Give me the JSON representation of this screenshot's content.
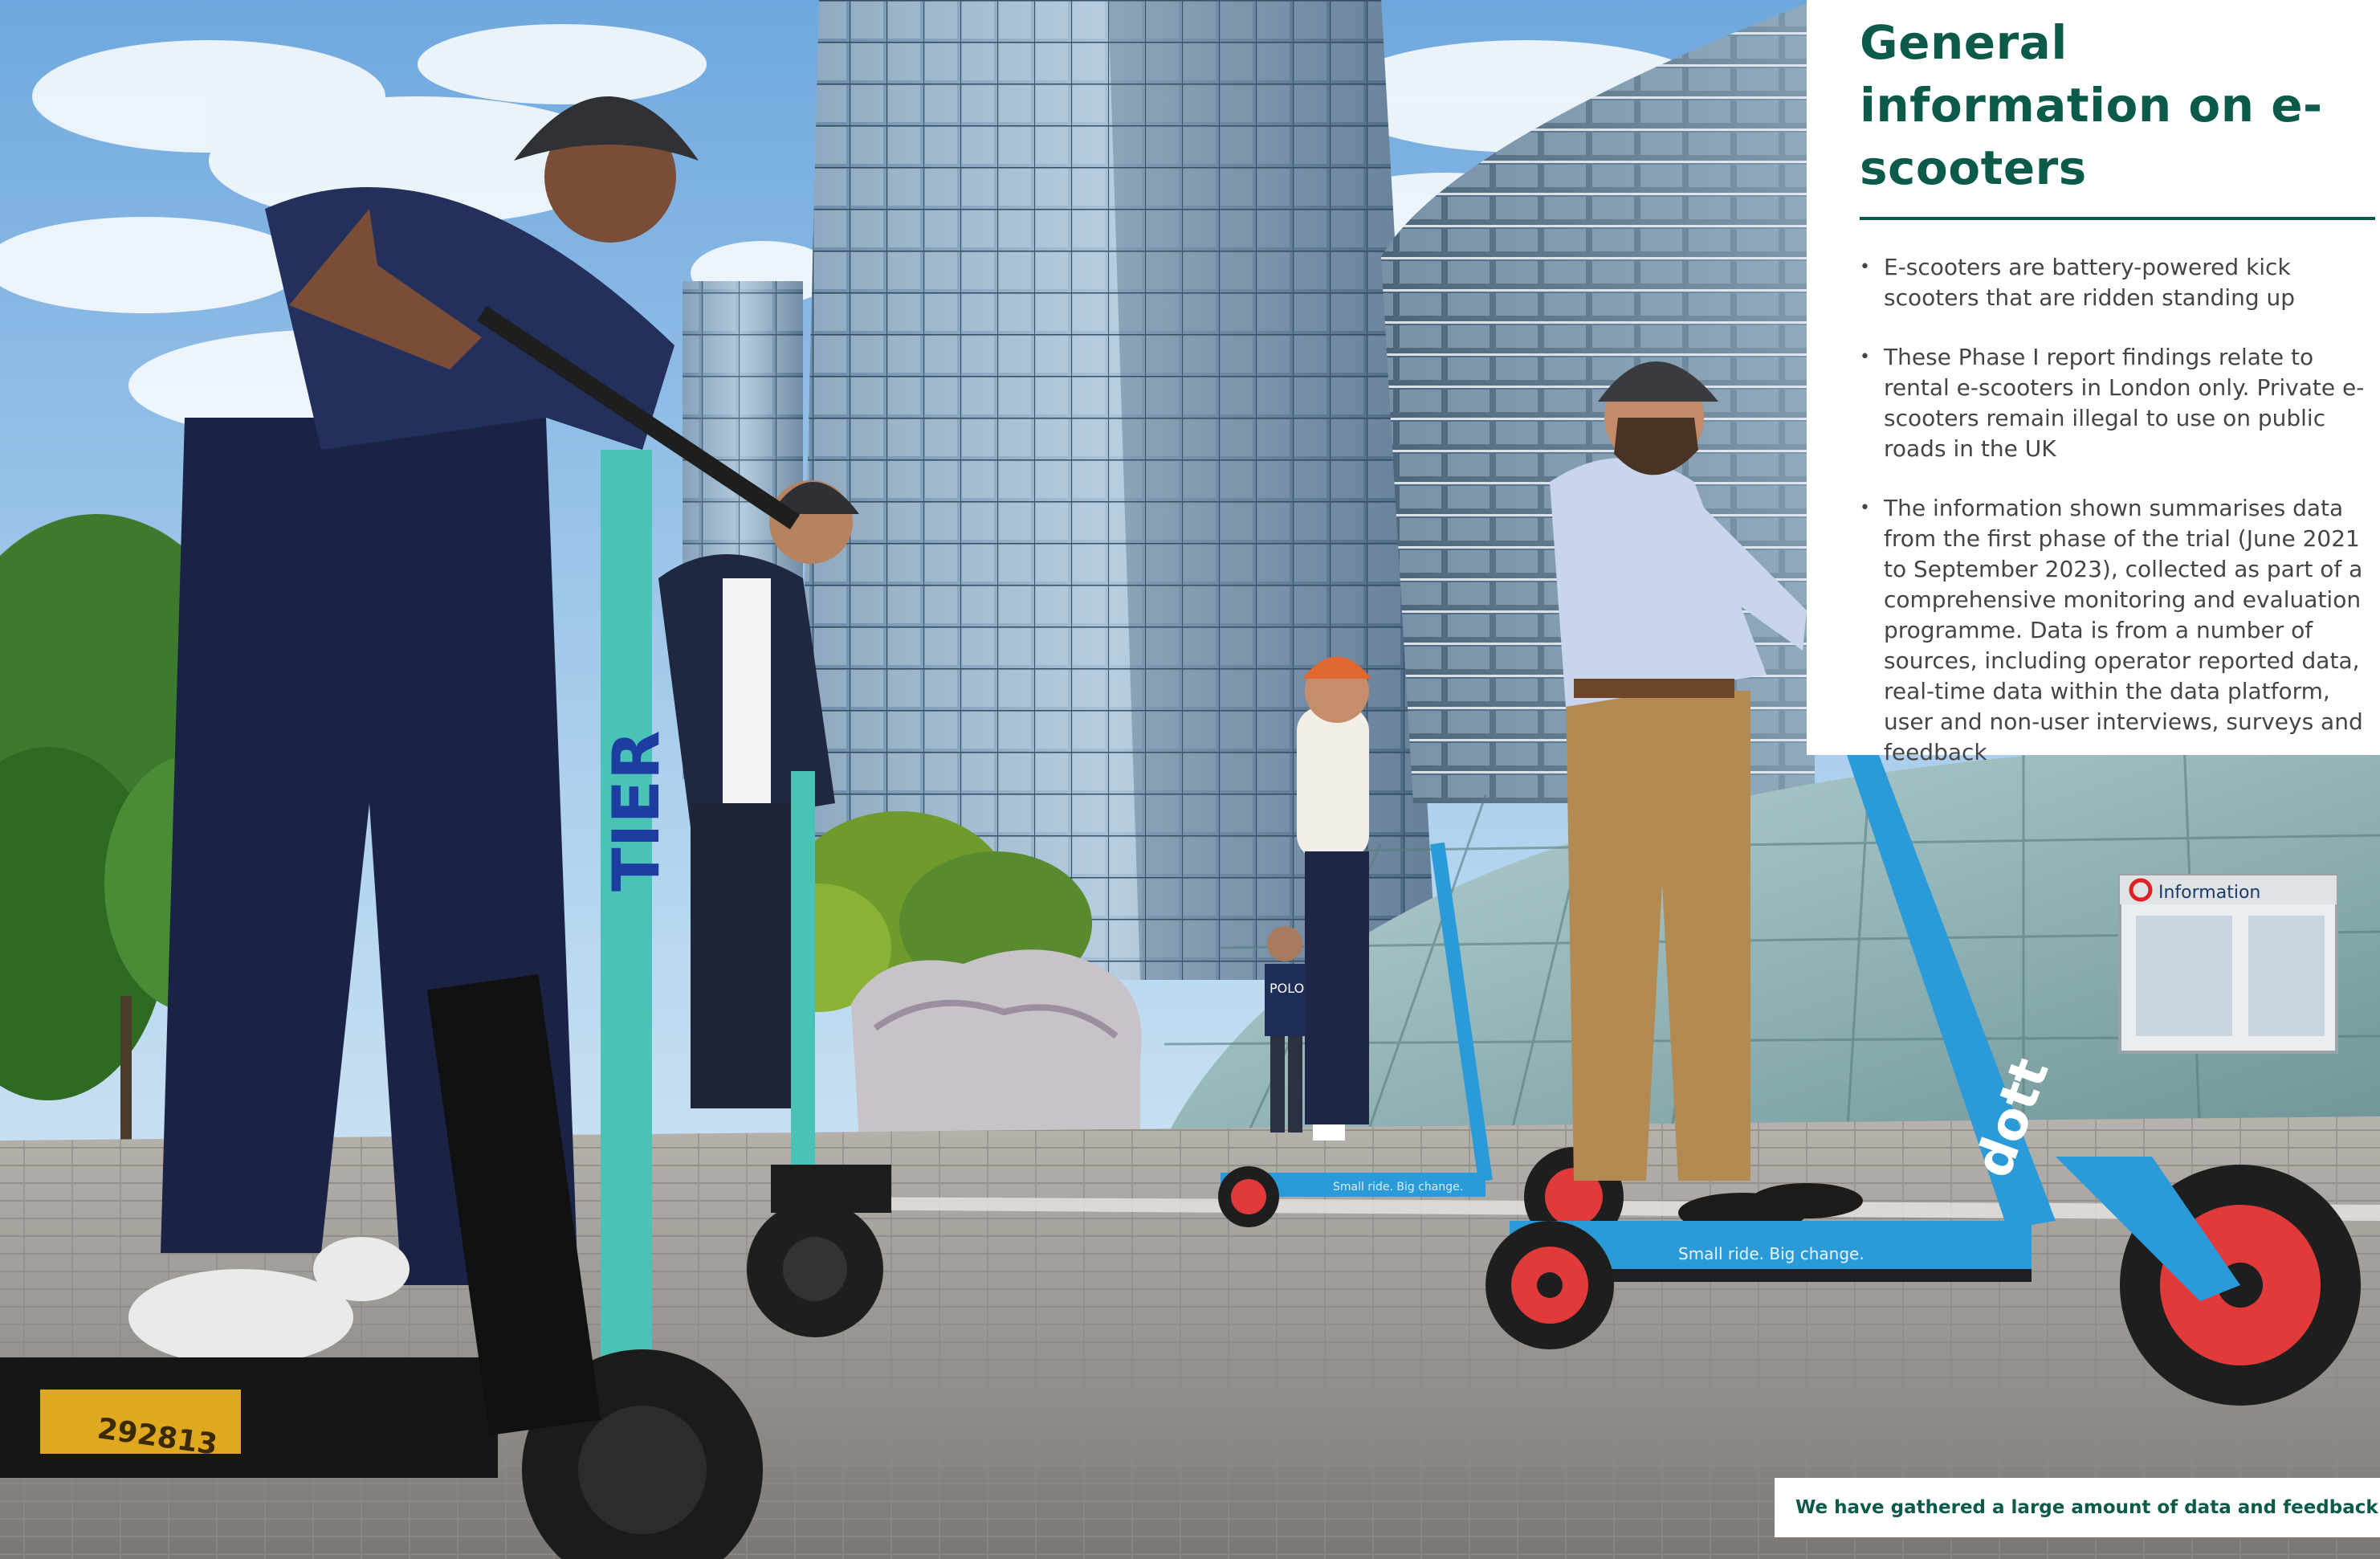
{
  "panel": {
    "title": "General information on e-scooters",
    "bullets": [
      "E-scooters are battery-powered kick scooters that are ridden standing up",
      "These Phase I report findings relate to rental e-scooters in London only. Private e-scooters remain illegal to use on public roads in the UK",
      "The information shown summarises data from the first phase of the trial (June 2021 to September 2023), collected as part of a comprehensive monitoring and evaluation programme. Data is from a number of sources, including operator reported data, real-time data within the data platform, user and non-user interviews, surveys and feedback"
    ],
    "bullet_glyph": "•"
  },
  "caption": {
    "text": "We have gathered a large amount of data and feedback"
  },
  "photo": {
    "signs": {
      "tier_brand": "TIER",
      "dott_brand": "dott",
      "dott_slogan": "Small ride. Big change.",
      "scooter_number": "292813",
      "information_sign": "Information",
      "shirt_text": "POLO"
    }
  },
  "colors": {
    "accent": "#0c5a4a",
    "body_text": "#454545",
    "tier_teal": "#49c2b8",
    "dott_blue": "#2a9bd8",
    "dott_red": "#e23a3a",
    "sky": "#8fc1e8"
  }
}
